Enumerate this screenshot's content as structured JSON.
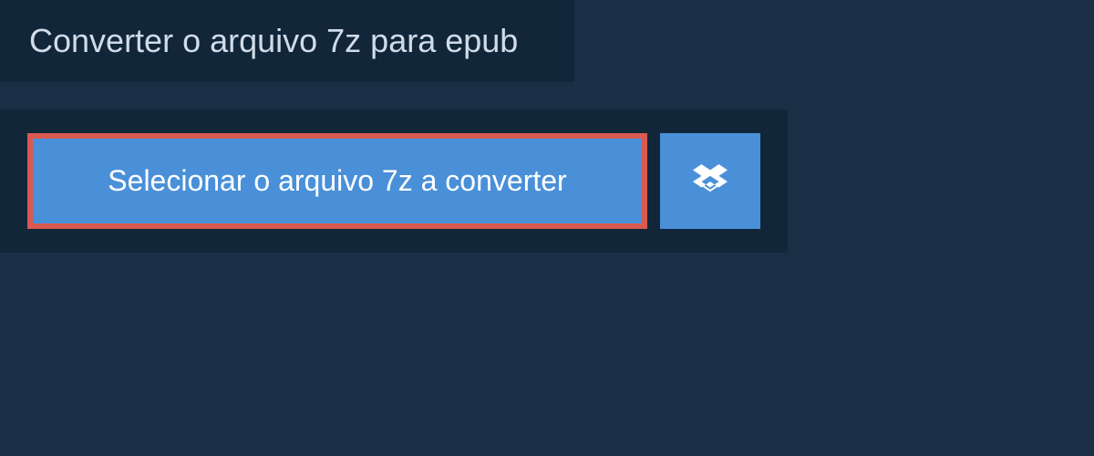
{
  "header": {
    "title": "Converter o arquivo 7z para epub"
  },
  "upload": {
    "select_file_label": "Selecionar o arquivo 7z a converter"
  }
}
